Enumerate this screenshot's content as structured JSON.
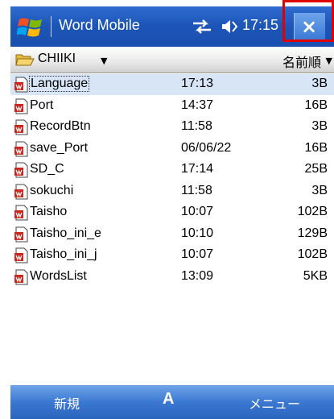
{
  "titlebar": {
    "app_title": "Word Mobile",
    "clock": "17:15",
    "close_label": "×"
  },
  "folderbar": {
    "folder_label": "CHIIKI",
    "sort_label": "名前順"
  },
  "files": [
    {
      "name": "Language",
      "time": "17:13",
      "size": "3B"
    },
    {
      "name": "Port",
      "time": "14:37",
      "size": "16B"
    },
    {
      "name": "RecordBtn",
      "time": "11:58",
      "size": "3B"
    },
    {
      "name": "save_Port",
      "time": "06/06/22",
      "size": "16B"
    },
    {
      "name": "SD_C",
      "time": "17:14",
      "size": "25B"
    },
    {
      "name": "sokuchi",
      "time": "11:58",
      "size": "3B"
    },
    {
      "name": "Taisho",
      "time": "10:07",
      "size": "102B"
    },
    {
      "name": "Taisho_ini_e",
      "time": "10:10",
      "size": "129B"
    },
    {
      "name": "Taisho_ini_j",
      "time": "10:07",
      "size": "102B"
    },
    {
      "name": "WordsList",
      "time": "13:09",
      "size": "5KB"
    }
  ],
  "softbar": {
    "left_label": "新規",
    "input_indicator": "A",
    "right_label": "メニュー"
  },
  "colors": {
    "titlebar_blue": "#1d56b8",
    "highlight_red": "#e00000",
    "selected_row": "#d7e5f7"
  }
}
